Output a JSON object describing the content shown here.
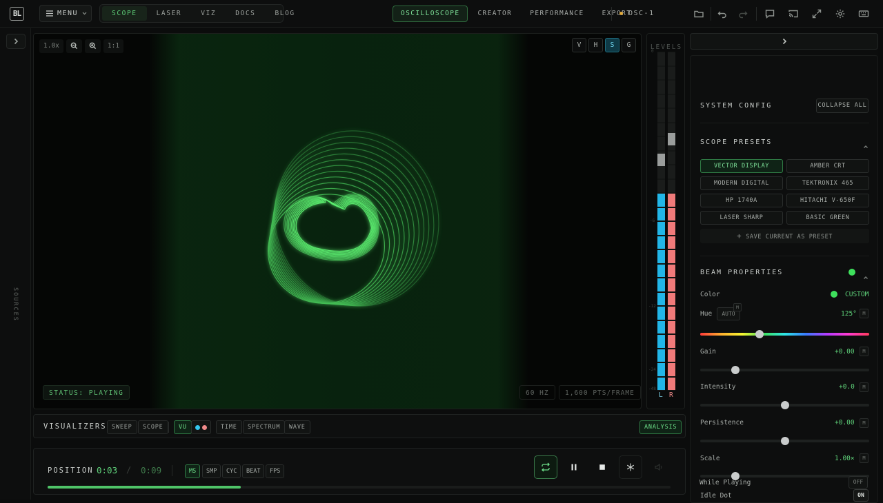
{
  "topbar": {
    "logo": "BL",
    "menu_label": "MENU",
    "nav_tabs": [
      {
        "label": "SCOPE",
        "active": true
      },
      {
        "label": "LASER",
        "active": false
      },
      {
        "label": "VIZ",
        "active": false
      },
      {
        "label": "DOCS",
        "active": false
      },
      {
        "label": "BLOG",
        "active": false
      }
    ],
    "mode_tabs": [
      {
        "label": "OSCILLOSCOPE",
        "active": true
      },
      {
        "label": "CREATOR",
        "active": false
      },
      {
        "label": "PERFORMANCE",
        "active": false
      },
      {
        "label": "EXPORT",
        "active": false
      }
    ],
    "device": "OSC-1",
    "icons": [
      "folder-icon",
      "undo-icon",
      "redo-icon",
      "chat-icon",
      "cast-icon",
      "fullscreen-icon",
      "settings-icon",
      "keyboard-icon"
    ]
  },
  "leftrail": {
    "label": "SOURCES"
  },
  "scope": {
    "zoom": "1.0x",
    "reset": "1:1",
    "view_buttons": [
      {
        "label": "V",
        "active": false
      },
      {
        "label": "H",
        "active": false
      },
      {
        "label": "S",
        "active": true
      },
      {
        "label": "G",
        "active": false
      }
    ],
    "status": "STATUS: PLAYING",
    "rate": "60 HZ",
    "points": "1,600 PTS/FRAME"
  },
  "levels": {
    "title": "LEVELS",
    "ticks": [
      "0",
      "-6",
      "-12",
      "-24",
      "-48"
    ],
    "left_label": "L",
    "right_label": "R",
    "left_level": 0.56,
    "right_level": 0.56,
    "left_peak": 0.7,
    "right_peak": 0.76
  },
  "visualizers": {
    "title": "VISUALIZERS",
    "buttons": [
      {
        "label": "SWEEP",
        "active": false
      },
      {
        "label": "SCOPE",
        "active": false
      },
      {
        "label": "VU",
        "active": true
      },
      {
        "label": "TIME",
        "active": false
      },
      {
        "label": "SPECTRUM",
        "active": false
      },
      {
        "label": "WAVE",
        "active": false
      }
    ],
    "analysis": "ANALYSIS"
  },
  "transport": {
    "label": "POSITION",
    "current": "0:03",
    "separator": "/",
    "duration": "0:09",
    "units": [
      {
        "label": "MS",
        "active": true
      },
      {
        "label": "SMP",
        "active": false
      },
      {
        "label": "CYC",
        "active": false
      },
      {
        "label": "BEAT",
        "active": false
      },
      {
        "label": "FPS",
        "active": false
      }
    ],
    "progress": 0.31
  },
  "panel": {
    "system_config": "SYSTEM CONFIG",
    "collapse_all": "COLLAPSE ALL",
    "scope_presets": "SCOPE PRESETS",
    "presets": [
      {
        "label": "VECTOR DISPLAY",
        "active": true
      },
      {
        "label": "AMBER CRT",
        "active": false
      },
      {
        "label": "MODERN DIGITAL",
        "active": false
      },
      {
        "label": "TEKTRONIX 465",
        "active": false
      },
      {
        "label": "HP 1740A",
        "active": false
      },
      {
        "label": "HITACHI V-650F",
        "active": false
      },
      {
        "label": "LASER SHARP",
        "active": false
      },
      {
        "label": "BASIC GREEN",
        "active": false
      }
    ],
    "save_preset": "SAVE CURRENT AS PRESET",
    "beam_properties": "BEAM PROPERTIES",
    "beam_color": "#3ee05c",
    "color_label": "Color",
    "color_value": "CUSTOM",
    "hue_label": "Hue",
    "hue_auto": "AUTO",
    "hue_value": "125°",
    "hue_pos": 0.35,
    "gain_label": "Gain",
    "gain_value": "+0.00",
    "gain_pos": 0.21,
    "intensity_label": "Intensity",
    "intensity_value": "+0.0",
    "intensity_pos": 0.5,
    "persistence_label": "Persistence",
    "persistence_value": "+0.00",
    "persistence_pos": 0.5,
    "scale_label": "Scale",
    "scale_value": "1.00×",
    "scale_pos": 0.21,
    "m_badge": "M",
    "idle_dot_label": "Idle Dot",
    "idle_dot_value": "ON",
    "while_playing_label": "While Playing",
    "while_playing_value": "OFF"
  }
}
